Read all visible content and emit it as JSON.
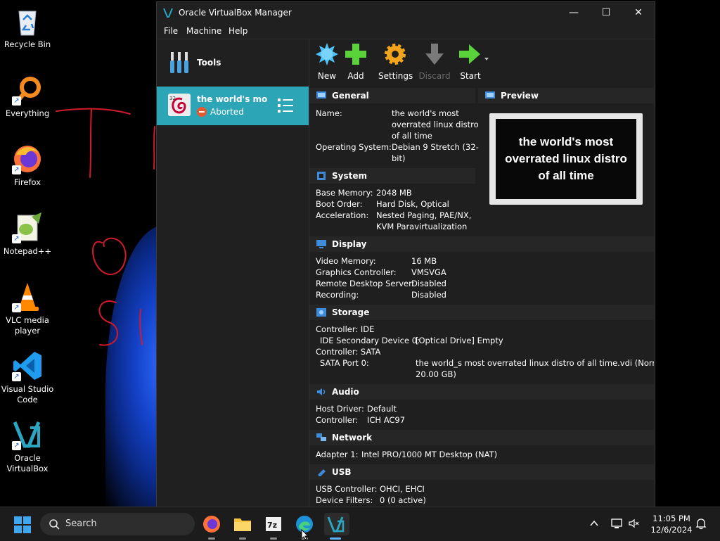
{
  "desktop": {
    "icons": [
      {
        "label": "Recycle Bin",
        "icon": "recycle-bin-icon"
      },
      {
        "label": "Everything",
        "icon": "everything-search-icon"
      },
      {
        "label": "Firefox",
        "icon": "firefox-icon"
      },
      {
        "label": "Notepad++",
        "icon": "notepad-plus-plus-icon"
      },
      {
        "label": "VLC media player",
        "icon": "vlc-cone-icon"
      },
      {
        "label": "Visual Studio Code",
        "icon": "vscode-icon"
      },
      {
        "label": "Oracle VirtualBox",
        "icon": "virtualbox-icon"
      }
    ]
  },
  "window": {
    "title": "Oracle VirtualBox Manager",
    "controls": {
      "minimize": "—",
      "maximize": "☐",
      "close": "✕"
    },
    "menu": [
      "File",
      "Machine",
      "Help"
    ]
  },
  "sidebar": {
    "tools_label": "Tools",
    "vm": {
      "name": "the world's mos...",
      "state": "Aborted"
    }
  },
  "toolbar": {
    "buttons": [
      {
        "label": "New",
        "enabled": true
      },
      {
        "label": "Add",
        "enabled": true
      },
      {
        "label": "Settings",
        "enabled": true
      },
      {
        "label": "Discard",
        "enabled": false
      },
      {
        "label": "Start",
        "enabled": true
      }
    ]
  },
  "details": {
    "general": {
      "title": "General",
      "name_label": "Name:",
      "name_lines": [
        "the world's most",
        "overrated linux distro",
        "of all time"
      ],
      "os_label": "Operating System:",
      "os_lines": [
        "Debian 9 Stretch (32-",
        "bit)"
      ]
    },
    "preview": {
      "title": "Preview",
      "screen_lines": [
        "the world's most",
        "overrated linux distro",
        "of all time"
      ]
    },
    "system": {
      "title": "System",
      "rows": [
        {
          "label": "Base Memory:",
          "value": "2048 MB"
        },
        {
          "label": "Boot Order:",
          "value": "Hard Disk, Optical"
        },
        {
          "label": "Acceleration:",
          "value": "Nested Paging, PAE/NX,"
        },
        {
          "label": "",
          "value": "KVM Paravirtualization"
        }
      ]
    },
    "display": {
      "title": "Display",
      "rows": [
        {
          "label": "Video Memory:",
          "value": "16 MB"
        },
        {
          "label": "Graphics Controller:",
          "value": "VMSVGA"
        },
        {
          "label": "Remote Desktop Server:",
          "value": "Disabled"
        },
        {
          "label": "Recording:",
          "value": "Disabled"
        }
      ]
    },
    "storage": {
      "title": "Storage",
      "controller_ide": "Controller: IDE",
      "ide_label": "IDE Secondary Device 0:",
      "ide_value": "[Optical Drive] Empty",
      "controller_sata": "Controller: SATA",
      "sata_label": "SATA Port 0:",
      "sata_value_1": "the world_s most overrated linux distro of all time.vdi (Normal,",
      "sata_value_2": "20.00 GB)"
    },
    "audio": {
      "title": "Audio",
      "rows": [
        {
          "label": "Host Driver:",
          "value": "Default"
        },
        {
          "label": "Controller:",
          "value": "ICH AC97"
        }
      ]
    },
    "network": {
      "title": "Network",
      "rows": [
        {
          "label": "Adapter 1:",
          "value": "Intel PRO/1000 MT Desktop (NAT)"
        }
      ]
    },
    "usb": {
      "title": "USB",
      "rows": [
        {
          "label": "USB Controller:",
          "value": "OHCI, EHCI"
        },
        {
          "label": "Device Filters:",
          "value": "0 (0 active)"
        }
      ]
    }
  },
  "taskbar": {
    "search_placeholder": "Search",
    "apps": [
      "firefox-icon",
      "file-explorer-icon",
      "7zip-icon",
      "edge-icon",
      "virtualbox-icon"
    ],
    "time": "11:05 PM",
    "date": "12/6/2024"
  },
  "colors": {
    "selection": "#2ca6b6",
    "window_bg": "#1f1f1f",
    "taskbar_bg": "#1c1c1c"
  }
}
